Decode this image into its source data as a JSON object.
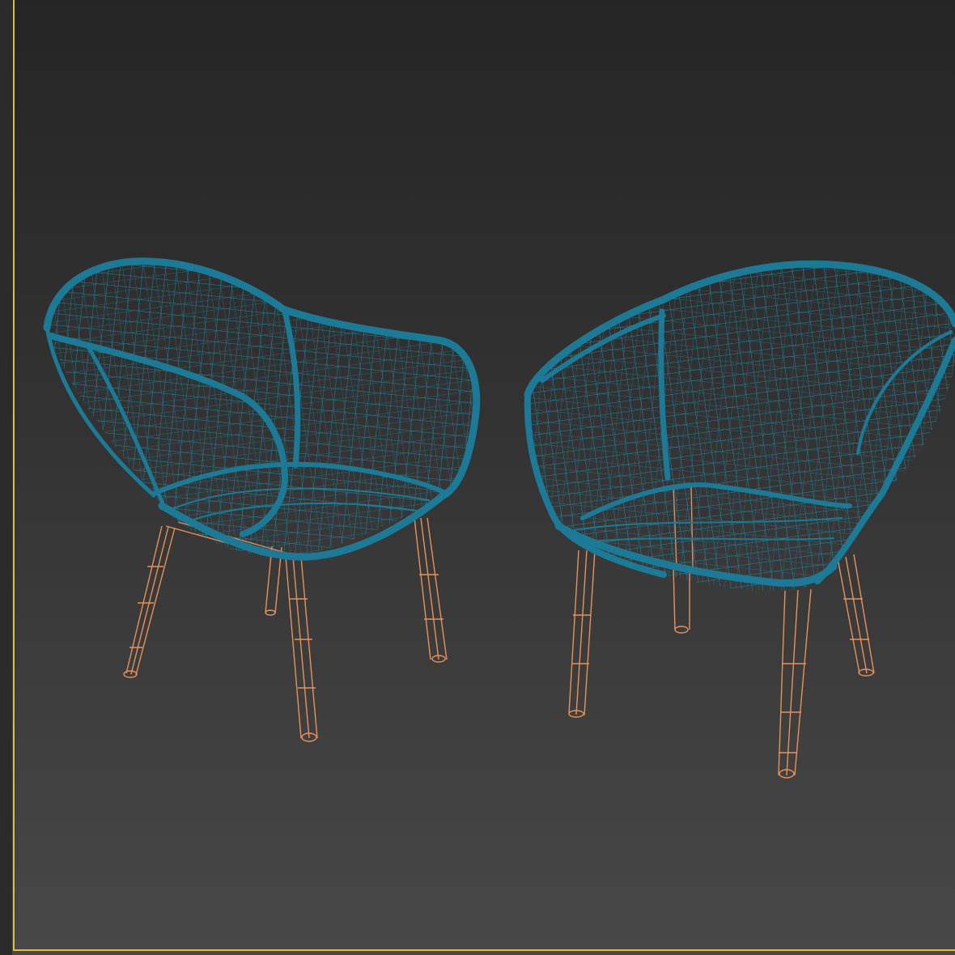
{
  "viewport": {
    "label": "3D viewport",
    "active_border_color": "#d8c23a",
    "background_top": "#252525",
    "background_bottom": "#484848"
  },
  "scene": {
    "objects": [
      {
        "name": "chair-left",
        "shell_color": "#1c7a96",
        "legs_color": "#e8925a",
        "display": "wireframe"
      },
      {
        "name": "chair-right",
        "shell_color": "#1c7a96",
        "legs_color": "#e8925a",
        "display": "wireframe"
      }
    ]
  }
}
